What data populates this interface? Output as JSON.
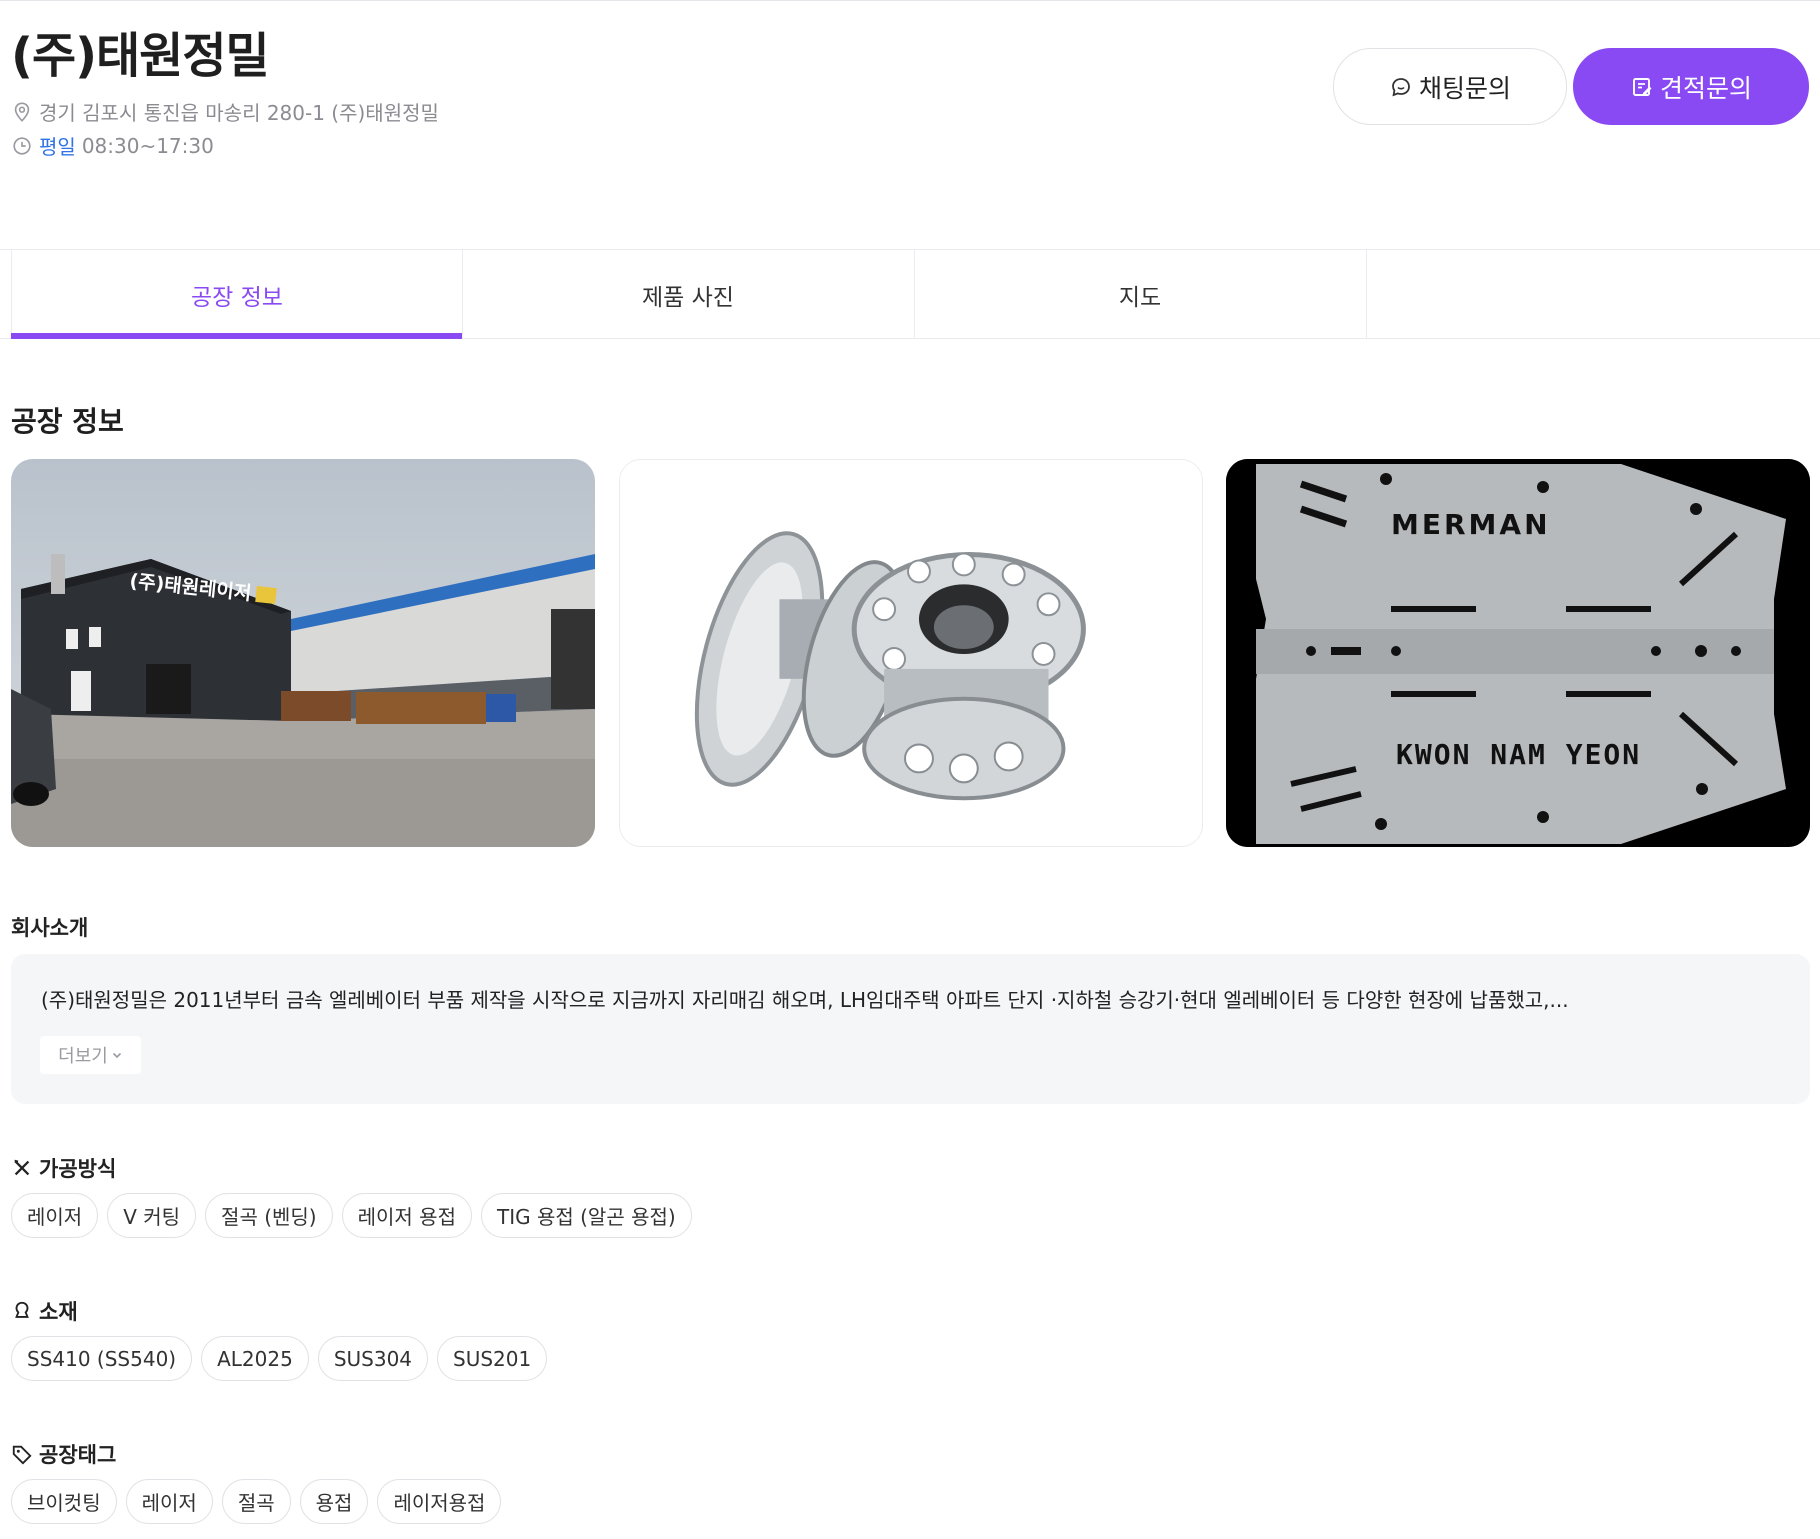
{
  "company": {
    "name": "(주)태원정밀",
    "address": "경기 김포시 통진읍 마송리 280-1 (주)태원정밀",
    "hours_day": "평일",
    "hours_time": "08:30~17:30"
  },
  "actions": {
    "chat_label": "채팅문의",
    "quote_label": "견적문의"
  },
  "tabs": [
    {
      "label": "공장 정보",
      "active": true
    },
    {
      "label": "제품 사진",
      "active": false
    },
    {
      "label": "지도",
      "active": false
    }
  ],
  "section": {
    "title": "공장 정보"
  },
  "photos": {
    "sign_text": "(주)태원레이저",
    "plate_text_top": "MERMAN",
    "plate_text_bottom": "KWON NAM YEON"
  },
  "intro": {
    "title": "회사소개",
    "text": "(주)태원정밀은 2011년부터 금속 엘레베이터 부품 제작을 시작으로 지금까지 자리매김 해오며, LH임대주택 아파트 단지 ·지하철 승강기·현대 엘레베이터 등 다양한 현장에 납품했고,...",
    "more_label": "더보기"
  },
  "processing": {
    "title": "가공방식",
    "chips": [
      "레이저",
      "V 커팅",
      "절곡 (벤딩)",
      "레이저 용접",
      "TIG 용접 (알곤 용접)"
    ]
  },
  "materials": {
    "title": "소재",
    "chips": [
      "SS410 (SS540)",
      "AL2025",
      "SUS304",
      "SUS201"
    ]
  },
  "tags": {
    "title": "공장태그",
    "chips": [
      "브이컷팅",
      "레이저",
      "절곡",
      "용접",
      "레이저용접"
    ]
  },
  "colors": {
    "accent": "#8a4af3",
    "weekday": "#2f73e6"
  }
}
